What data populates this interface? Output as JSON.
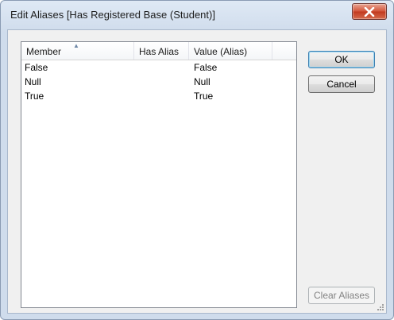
{
  "window": {
    "title": "Edit Aliases [Has Registered Base (Student)]",
    "close_glyph": "X"
  },
  "list": {
    "columns": [
      "Member",
      "Has Alias",
      "Value (Alias)"
    ],
    "sorted_column": "Member",
    "sort_direction": "ascending",
    "rows": [
      {
        "member": "False",
        "has_alias": "",
        "value": "False"
      },
      {
        "member": "Null",
        "has_alias": "",
        "value": "Null"
      },
      {
        "member": "True",
        "has_alias": "",
        "value": "True"
      }
    ]
  },
  "buttons": {
    "ok": "OK",
    "cancel": "Cancel",
    "clear_aliases": "Clear Aliases"
  },
  "colors": {
    "close_button": "#c9462b",
    "default_button_border": "#3c7fb1"
  }
}
